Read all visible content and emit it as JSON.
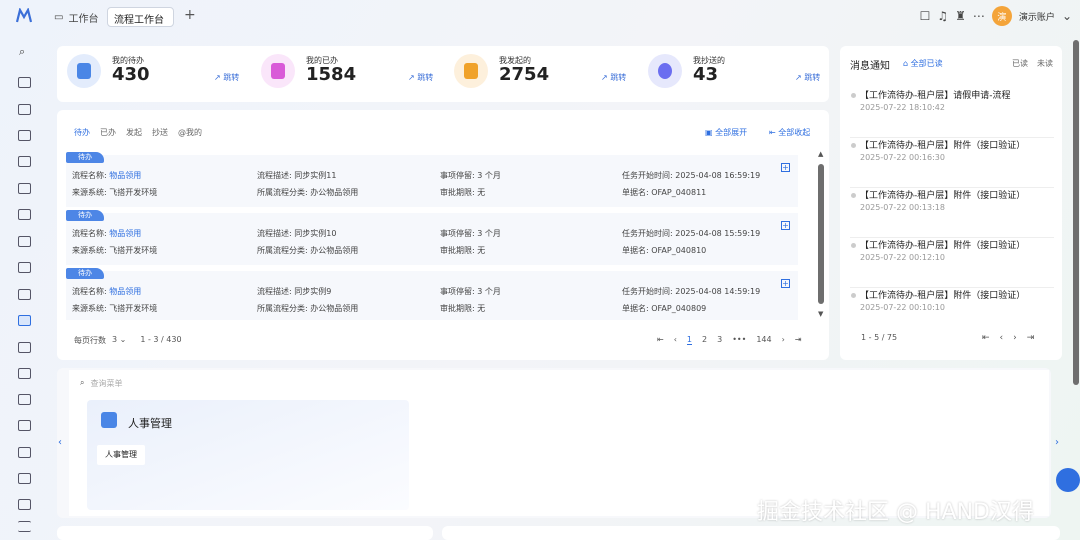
{
  "topbar": {
    "tab_home": "工作台",
    "tab_active": "流程工作台",
    "tab_add": "+",
    "account": "演示账户",
    "avatar_text": "演"
  },
  "stats": [
    {
      "label": "我的待办",
      "value": "430",
      "jump": "↗ 跳转",
      "color": "#4a86e6"
    },
    {
      "label": "我的已办",
      "value": "1584",
      "jump": "↗ 跳转",
      "color": "#d95ad8"
    },
    {
      "label": "我发起的",
      "value": "2754",
      "jump": "↗ 跳转",
      "color": "#f0a22a"
    },
    {
      "label": "我抄送的",
      "value": "43",
      "jump": "↗ 跳转",
      "color": "#6b6ef0"
    }
  ],
  "subtabs": [
    "待办",
    "已办",
    "发起",
    "抄送",
    "@我的"
  ],
  "expand_all": "全部展开",
  "collapse_all": "全部收起",
  "tasks": [
    {
      "tag": "待办",
      "name_label": "流程名称:",
      "name": "物品领用",
      "desc_label": "流程描述:",
      "desc": "同步实例11",
      "stay_label": "事项停留:",
      "stay": "3 个月",
      "start_label": "任务开始时间:",
      "start": "2025-04-08 16:59:19",
      "source_label": "来源系统:",
      "source": "飞搭开发环境",
      "cat_label": "所属流程分类:",
      "cat": "办公物品领用",
      "deadline_label": "审批期限:",
      "deadline": "无",
      "doc_label": "单据名:",
      "doc": "OFAP_040811"
    },
    {
      "tag": "待办",
      "name_label": "流程名称:",
      "name": "物品领用",
      "desc_label": "流程描述:",
      "desc": "同步实例10",
      "stay_label": "事项停留:",
      "stay": "3 个月",
      "start_label": "任务开始时间:",
      "start": "2025-04-08 15:59:19",
      "source_label": "来源系统:",
      "source": "飞搭开发环境",
      "cat_label": "所属流程分类:",
      "cat": "办公物品领用",
      "deadline_label": "审批期限:",
      "deadline": "无",
      "doc_label": "单据名:",
      "doc": "OFAP_040810"
    },
    {
      "tag": "待办",
      "name_label": "流程名称:",
      "name": "物品领用",
      "desc_label": "流程描述:",
      "desc": "同步实例9",
      "stay_label": "事项停留:",
      "stay": "3 个月",
      "start_label": "任务开始时间:",
      "start": "2025-04-08 14:59:19",
      "source_label": "来源系统:",
      "source": "飞搭开发环境",
      "cat_label": "所属流程分类:",
      "cat": "办公物品领用",
      "deadline_label": "审批期限:",
      "deadline": "无",
      "doc_label": "单据名:",
      "doc": "OFAP_040809"
    }
  ],
  "pagination": {
    "rows_label": "每页行数",
    "rows": "3 ⌄",
    "range": "1 - 3 / 430",
    "pages": [
      "1",
      "2",
      "3",
      "•••",
      "144"
    ]
  },
  "messages": {
    "title": "消息通知",
    "read_all": "全部已读",
    "filter_read": "已读",
    "filter_unread": "未读",
    "items": [
      {
        "title": "【工作流待办-租户层】请假申请-流程",
        "date": "2025-07-22 18:10:42"
      },
      {
        "title": "【工作流待办-租户层】附件（接口验证）",
        "date": "2025-07-22 00:16:30"
      },
      {
        "title": "【工作流待办-租户层】附件（接口验证）",
        "date": "2025-07-22 00:13:18"
      },
      {
        "title": "【工作流待办-租户层】附件（接口验证）",
        "date": "2025-07-22 00:12:10"
      },
      {
        "title": "【工作流待办-租户层】附件（接口验证）",
        "date": "2025-07-22 00:10:10"
      }
    ],
    "range": "1 - 5 / 75"
  },
  "menu": {
    "search_placeholder": "查询菜单",
    "hr_title": "人事管理",
    "hr_item": "人事管理"
  },
  "watermark": "掘金技术社区 @ HAND汉得"
}
